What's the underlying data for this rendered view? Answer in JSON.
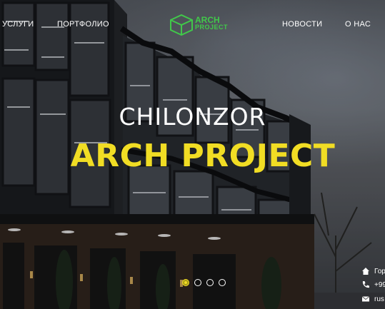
{
  "nav": {
    "services": "УСЛУГИ",
    "portfolio": "ПОРТФОЛИО",
    "news": "НОВОСТИ",
    "about": "О НАС"
  },
  "logo": {
    "line1": "ARCH",
    "line2": "PROJECT"
  },
  "hero": {
    "headline": "CHILONZOR",
    "title": "ARCH PROJECT"
  },
  "slider": {
    "count": 4,
    "active_index": 0
  },
  "contacts": {
    "address": "Гор",
    "phone": "+99",
    "email": "rus"
  },
  "colors": {
    "accent": "#f1dd24",
    "logo_green": "#41c84a"
  },
  "icons": {
    "address": "home-icon",
    "phone": "phone-icon",
    "email": "envelope-icon"
  }
}
